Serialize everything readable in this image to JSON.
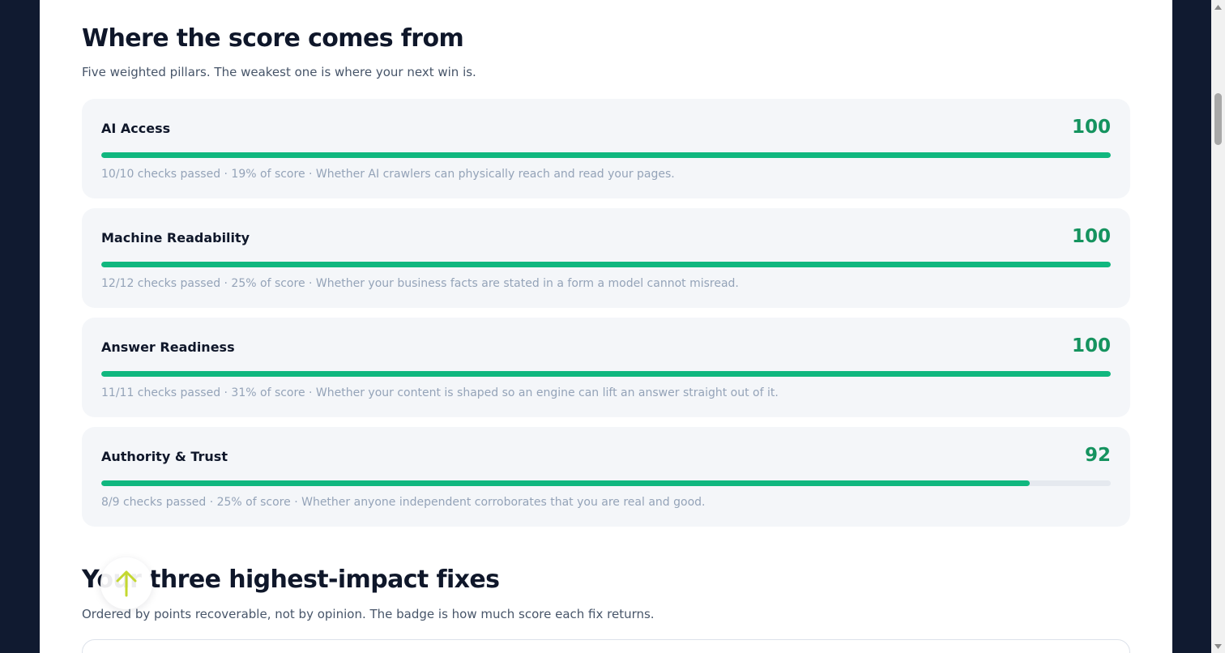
{
  "score_section": {
    "title": "Where the score comes from",
    "subtitle": "Five weighted pillars. The weakest one is where your next win is."
  },
  "pillars": [
    {
      "name": "AI Access",
      "score": "100",
      "progress_percent": 100,
      "meta": "10/10 checks passed · 19% of score · Whether AI crawlers can physically reach and read your pages."
    },
    {
      "name": "Machine Readability",
      "score": "100",
      "progress_percent": 100,
      "meta": "12/12 checks passed · 25% of score · Whether your business facts are stated in a form a model cannot misread."
    },
    {
      "name": "Answer Readiness",
      "score": "100",
      "progress_percent": 100,
      "meta": "11/11 checks passed · 31% of score · Whether your content is shaped so an engine can lift an answer straight out of it."
    },
    {
      "name": "Authority & Trust",
      "score": "92",
      "progress_percent": 92,
      "meta": "8/9 checks passed · 25% of score · Whether anyone independent corroborates that you are real and good."
    }
  ],
  "fixes_section": {
    "title": "Your three highest-impact fixes",
    "subtitle": "Ordered by points recoverable, not by opinion. The badge is how much score each fix returns."
  },
  "scroll_top_button": {
    "icon": "arrow-up-icon"
  },
  "colors": {
    "score_green": "#15935f",
    "bar_green": "#10b77f",
    "arrow_lime": "#c4d82f",
    "page_frame": "#101a30"
  }
}
